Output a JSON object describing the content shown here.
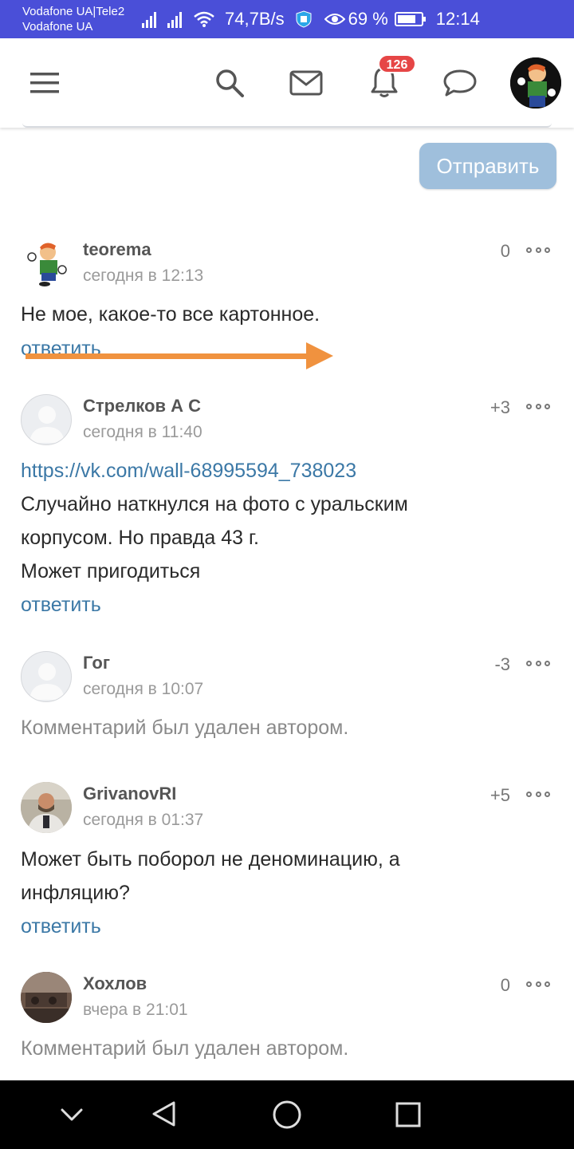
{
  "status_bar": {
    "carrier_1": "Vodafone UA|Tele2",
    "carrier_2": "Vodafone UA",
    "speed": "74,7B/s",
    "battery": "69 %",
    "time": "12:14"
  },
  "nav": {
    "notifications_count": "126"
  },
  "form": {
    "send_label": "Отправить"
  },
  "comments": [
    {
      "author": "teorema",
      "time": "сегодня в 12:13",
      "score": "0",
      "text": "Не мое, какое-то все картонное.",
      "reply": "ответить"
    },
    {
      "author": "Стрелков А С",
      "time": "сегодня в 11:40",
      "score": "+3",
      "link": "https://vk.com/wall-68995594_738023",
      "text_lines": [
        "Случайно наткнулся на фото с уральским",
        "корпусом. Но правда 43 г.",
        "Может пригодиться"
      ],
      "reply": "ответить"
    },
    {
      "author": "Гог",
      "time": "сегодня в 10:07",
      "score": "-3",
      "deleted": "Комментарий был удален автором."
    },
    {
      "author": "GrivanovRI",
      "time": "сегодня в 01:37",
      "score": "+5",
      "text_lines": [
        "Может быть поборол не деноминацию, а",
        "инфляцию?"
      ],
      "reply": "ответить"
    },
    {
      "author": "Хохлов",
      "time": "вчера в 21:01",
      "score": "0",
      "deleted": "Комментарий был удален автором."
    }
  ],
  "colors": {
    "status_bar": "#4a4fd8",
    "link": "#3b78a6",
    "send_button": "#9fbfdc",
    "badge": "#e64646",
    "arrow": "#f0923f"
  }
}
